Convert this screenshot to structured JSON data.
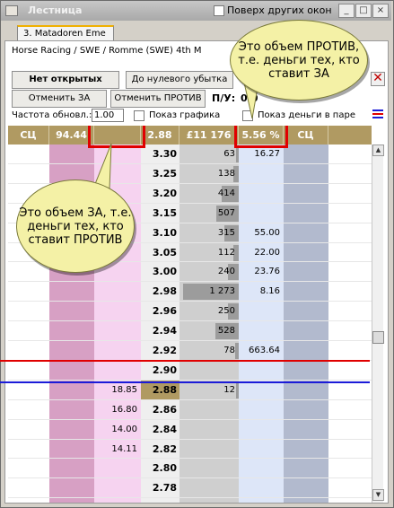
{
  "window": {
    "title": "Лестница",
    "on_top_label": "Поверх других окон",
    "buttons": [
      "_",
      "□",
      "×"
    ]
  },
  "tab": {
    "label": "3. Matadoren Eme"
  },
  "race": {
    "path": "Horse Racing / SWE / Romme (SWE) 4th M"
  },
  "toolbar": {
    "no_open_label": "Нет открытых",
    "to_zero_label": "До нулевого убытка",
    "cancel_back_label": "Отменить ЗА",
    "cancel_lay_label": "Отменить ПРОТИВ",
    "pl_label": "П/У:",
    "pl_value": "0.0",
    "close_symbol": "✕"
  },
  "options": {
    "refresh_label": "Частота обновл.:",
    "refresh_value": "1.00",
    "show_chart_label": "Показ графика",
    "show_pair_label": "Показ деньги в паре"
  },
  "ladder": {
    "headers": {
      "left_sc": "СЦ",
      "back_percent": "94.44 %",
      "ltp": "2.88",
      "matched": "£11 176",
      "lay_percent": "5.56 %",
      "right_sc": "СЦ"
    },
    "rows": [
      {
        "price": "3.30",
        "back": "",
        "traded": "63",
        "lay": "16.27",
        "traded_fraction": 0.05
      },
      {
        "price": "3.25",
        "back": "",
        "traded": "138",
        "lay": "",
        "traded_fraction": 0.1
      },
      {
        "price": "3.20",
        "back": "",
        "traded": "414",
        "lay": "",
        "traded_fraction": 0.3
      },
      {
        "price": "3.15",
        "back": "",
        "traded": "507",
        "lay": "",
        "traded_fraction": 0.4
      },
      {
        "price": "3.10",
        "back": "",
        "traded": "315",
        "lay": "55.00",
        "traded_fraction": 0.25
      },
      {
        "price": "3.05",
        "back": "",
        "traded": "112",
        "lay": "22.00",
        "traded_fraction": 0.09
      },
      {
        "price": "3.00",
        "back": "",
        "traded": "240",
        "lay": "23.76",
        "traded_fraction": 0.19
      },
      {
        "price": "2.98",
        "back": "",
        "traded": "1 273",
        "lay": "8.16",
        "traded_fraction": 1.0
      },
      {
        "price": "2.96",
        "back": "",
        "traded": "250",
        "lay": "",
        "traded_fraction": 0.2
      },
      {
        "price": "2.94",
        "back": "",
        "traded": "528",
        "lay": "",
        "traded_fraction": 0.42
      },
      {
        "price": "2.92",
        "back": "",
        "traded": "78",
        "lay": "663.64",
        "traded_fraction": 0.06
      },
      {
        "price": "2.90",
        "back": "",
        "traded": "",
        "lay": "",
        "traded_fraction": 0
      },
      {
        "price": "2.88",
        "back": "18.85",
        "traded": "12",
        "lay": "",
        "traded_fraction": 0.01,
        "is_ltp": true
      },
      {
        "price": "2.86",
        "back": "16.80",
        "traded": "",
        "lay": "",
        "traded_fraction": 0
      },
      {
        "price": "2.84",
        "back": "14.00",
        "traded": "",
        "lay": "",
        "traded_fraction": 0
      },
      {
        "price": "2.82",
        "back": "14.11",
        "traded": "",
        "lay": "",
        "traded_fraction": 0
      },
      {
        "price": "2.80",
        "back": "",
        "traded": "",
        "lay": "",
        "traded_fraction": 0
      },
      {
        "price": "2.78",
        "back": "",
        "traded": "",
        "lay": "",
        "traded_fraction": 0
      }
    ]
  },
  "annotations": {
    "lay_bubble": "Это объем ПРОТИВ, т.е. деньги тех, кто ставит ЗА",
    "back_bubble": "Это объем ЗА, т.е. деньги тех, кто ставит ПРОТИВ"
  },
  "colors": {
    "header_gold": "#b09a62",
    "left_sc_pink": "#d7a0c4",
    "back_pink": "#f6d3f0",
    "price_grey": "#efefef",
    "traded_grey": "#cfcfcf",
    "lay_blue": "#dde6f8",
    "right_sc_blue": "#b2bace",
    "ltp_gold": "#b09a62",
    "red_marker": "#e00000",
    "blue_marker": "#1b1bd8",
    "bubble_yellow": "#f4f1a6"
  }
}
